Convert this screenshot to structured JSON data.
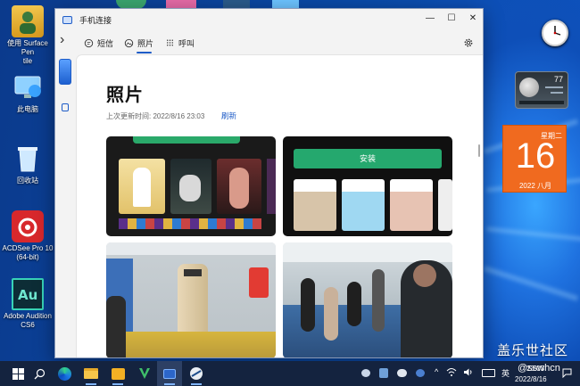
{
  "desktop": {
    "icons": [
      {
        "label": "使用 Surface Pen",
        "sub": "tile"
      },
      {
        "label": "此电脑"
      },
      {
        "label": "回收站"
      },
      {
        "label": "ACDSee Pro 10",
        "sub": "(64-bit)"
      },
      {
        "label": "Adobe Audition",
        "sub": "CS6"
      }
    ],
    "calendar": {
      "weekday": "星期二",
      "day": "16",
      "year_month": "2022 八月"
    },
    "weather": {
      "temp": "77"
    },
    "watermark": {
      "text": "盖乐世社区",
      "handle": "@sswhcn"
    }
  },
  "window": {
    "title": "手机连接",
    "controls": {
      "minimize": "—",
      "maximize": "☐",
      "close": "✕"
    },
    "nav": {
      "back_glyph": "›",
      "tabs": [
        {
          "label": "短信",
          "icon": "message-icon"
        },
        {
          "label": "照片",
          "icon": "photos-icon"
        },
        {
          "label": "呼叫",
          "icon": "dialpad-icon"
        }
      ],
      "settings_icon": "gear-icon"
    },
    "page": {
      "title": "照片",
      "updated": "上次更新时间: 2022/8/16 23:03",
      "refresh": "刷新"
    },
    "photos": [
      {
        "desc": "app screenshot",
        "button": ""
      },
      {
        "desc": "app screenshot",
        "button": "安装"
      },
      {
        "desc": "subway station"
      },
      {
        "desc": "subway car"
      }
    ]
  },
  "taskbar": {
    "ime": "英",
    "time": "23:03",
    "date": "2022/8/16"
  },
  "colors": {
    "accent": "#1e5cc7",
    "calendar": "#f06a1f",
    "taskbar": "#14233f"
  }
}
